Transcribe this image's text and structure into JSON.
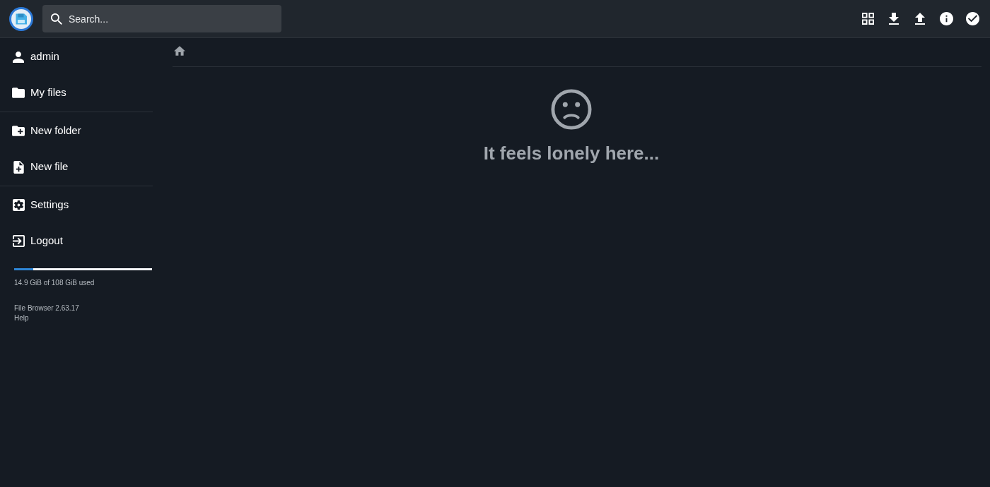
{
  "header": {
    "search": {
      "placeholder": "Search..."
    }
  },
  "sidebar": {
    "sections": [
      {
        "items": [
          {
            "label": "admin"
          },
          {
            "label": "My files"
          }
        ]
      },
      {
        "items": [
          {
            "label": "New folder"
          },
          {
            "label": "New file"
          }
        ]
      },
      {
        "items": [
          {
            "label": "Settings"
          },
          {
            "label": "Logout"
          }
        ]
      }
    ],
    "storage": {
      "level": 0.138,
      "reading": "14.9 GiB of 108 GiB used"
    },
    "footer": {
      "version": "File Browser 2.63.17",
      "help": "Help"
    }
  },
  "main": {
    "empty_state": {
      "message": "It feels lonely here..."
    }
  }
}
